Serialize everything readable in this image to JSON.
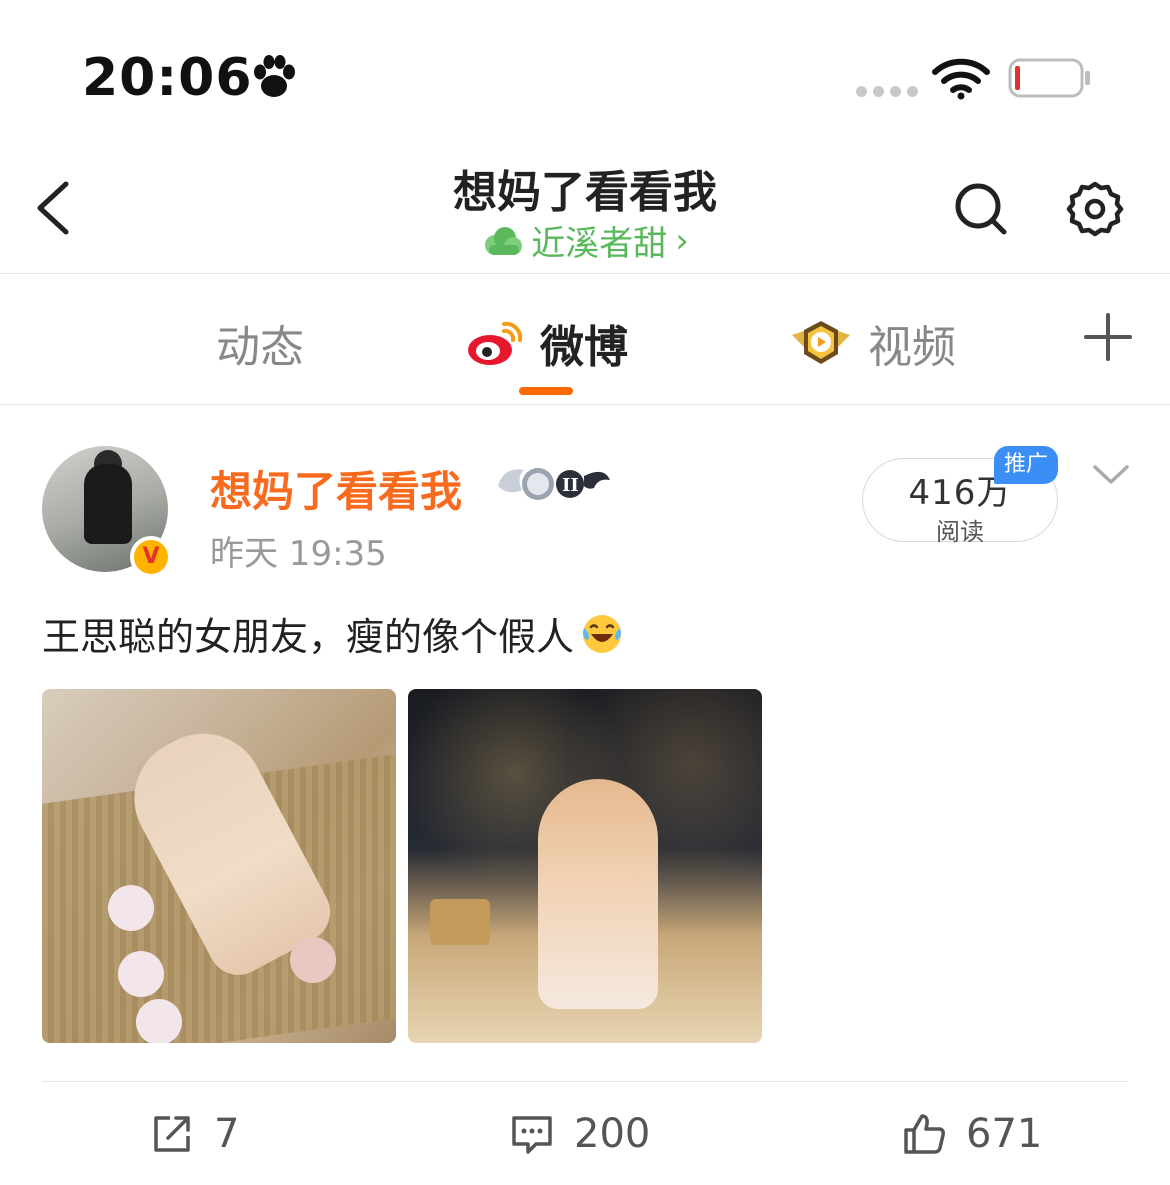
{
  "status_bar": {
    "time": "20:06",
    "paw_icon": "paw-icon",
    "signal_icon": "signal-dots-icon",
    "wifi_icon": "wifi-icon",
    "battery_icon": "battery-low-icon",
    "battery_color": "#e3312d"
  },
  "nav": {
    "title": "想妈了看看我",
    "subtitle": "近溪者甜",
    "subtitle_arrow": "›",
    "subtitle_color": "#59b85c"
  },
  "tabs": [
    {
      "label": "动态",
      "active": false
    },
    {
      "label": "微博",
      "active": true
    },
    {
      "label": "视频",
      "active": false
    }
  ],
  "accent_color": "#ff6a00",
  "post": {
    "author": "想妈了看看我",
    "author_color": "#f86b1e",
    "verified_badge": "V",
    "time": "昨天 19:35",
    "read_count": "416万",
    "read_label": "阅读",
    "promo_tag": "推广",
    "text": "王思聪的女朋友，瘦的像个假人",
    "emoji": "laugh-crying-icon",
    "images": [
      "photo-1",
      "photo-2"
    ],
    "actions": {
      "share_count": "7",
      "comment_count": "200",
      "like_count": "671"
    }
  }
}
